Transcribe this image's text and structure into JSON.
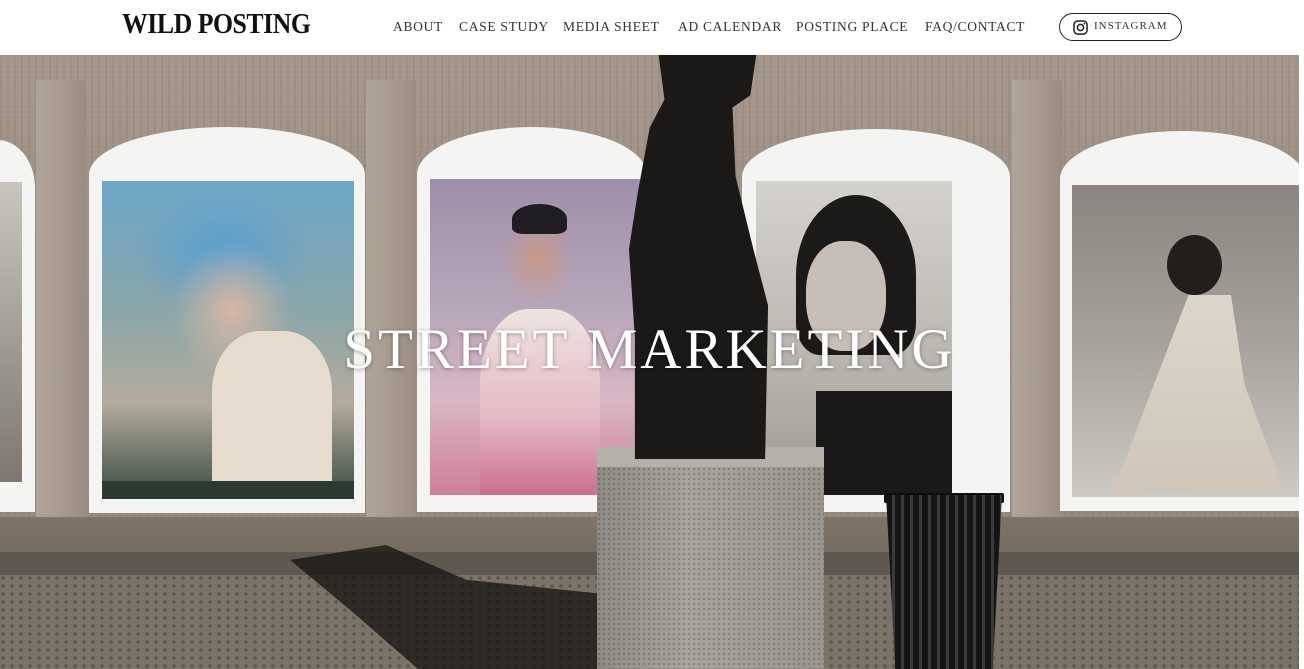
{
  "brand": {
    "logo_text": "WILD POSTING"
  },
  "nav": {
    "items": [
      {
        "label": "ABOUT"
      },
      {
        "label": "CASE STUDY"
      },
      {
        "label": "MEDIA SHEET"
      },
      {
        "label": "AD CALENDAR"
      },
      {
        "label": "POSTING PLACE"
      },
      {
        "label": "FAQ/CONTACT"
      }
    ],
    "instagram": {
      "label": "INSTAGRAM",
      "icon": "instagram-icon"
    }
  },
  "hero": {
    "title": "STREET MARKETING"
  },
  "colors": {
    "header_bg": "#ffffff",
    "text_dark": "#111111",
    "nav_text": "#333333",
    "hero_title": "#ffffff"
  }
}
